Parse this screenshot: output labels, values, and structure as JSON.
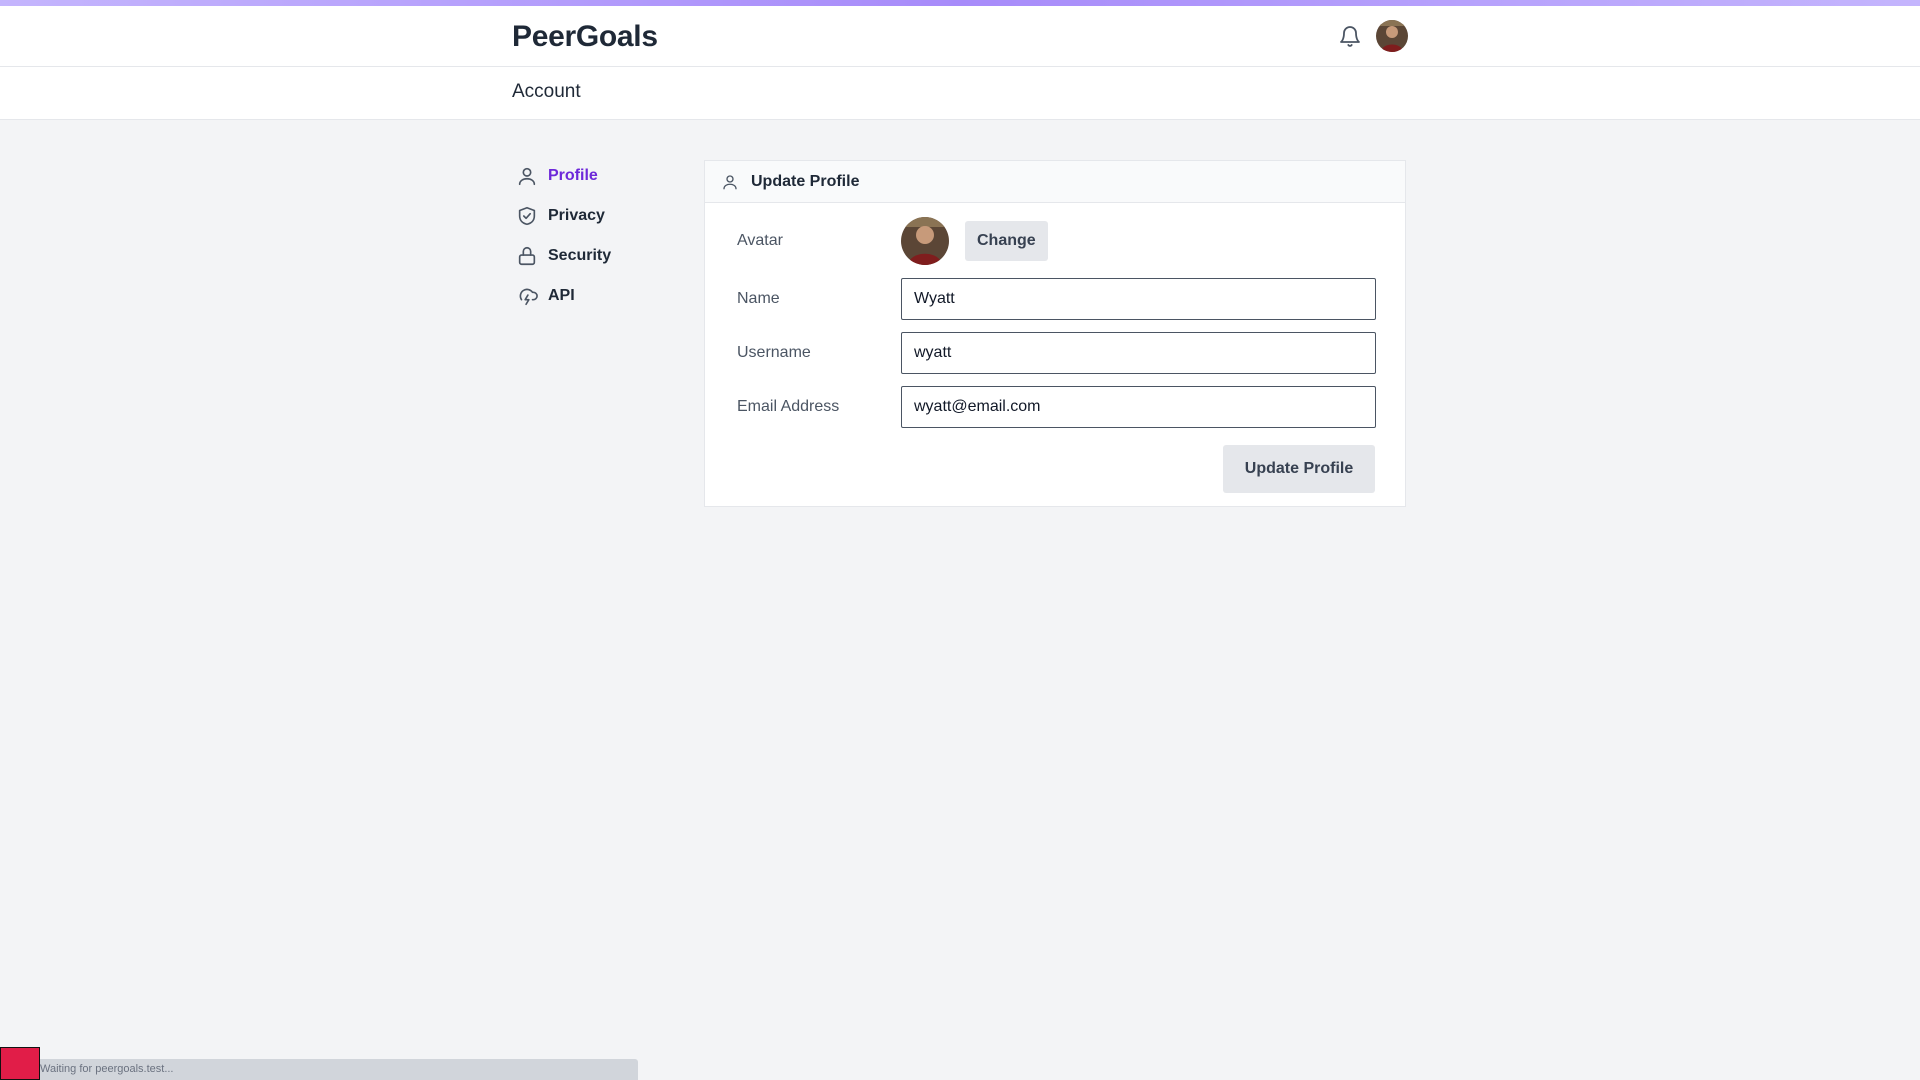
{
  "app": {
    "brand": "PeerGoals",
    "header_icons": [
      "bell-icon",
      "user-avatar"
    ],
    "accent_color": "#6d28d9"
  },
  "page": {
    "title": "Account"
  },
  "sidenav": {
    "items": [
      {
        "label": "Profile",
        "icon": "user-icon",
        "active": true
      },
      {
        "label": "Privacy",
        "icon": "shield-check-icon",
        "active": false
      },
      {
        "label": "Security",
        "icon": "lock-icon",
        "active": false
      },
      {
        "label": "API",
        "icon": "cloud-lightning-icon",
        "active": false
      }
    ]
  },
  "card": {
    "title": "Update Profile",
    "avatar_label": "Avatar",
    "change_label": "Change",
    "fields": {
      "name": {
        "label": "Name",
        "value": "Wyatt"
      },
      "username": {
        "label": "Username",
        "value": "wyatt"
      },
      "email": {
        "label": "Email Address",
        "value": "wyatt@email.com"
      }
    },
    "submit_label": "Update Profile"
  },
  "status": {
    "text": "Waiting for peergoals.test..."
  }
}
